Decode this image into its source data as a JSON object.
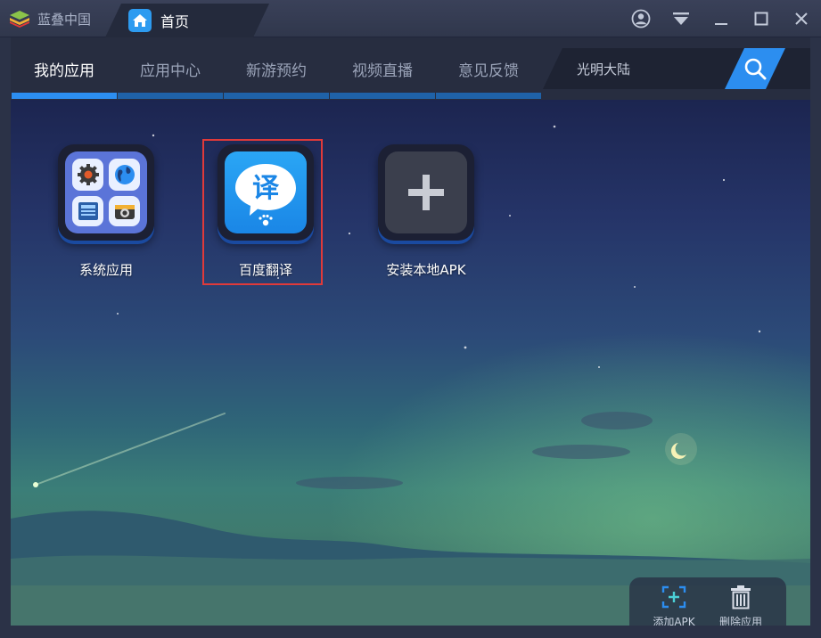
{
  "titlebar": {
    "app_name": "蓝叠中国",
    "home_tab": "首页"
  },
  "nav": {
    "tabs": [
      {
        "label": "我的应用",
        "active": true
      },
      {
        "label": "应用中心",
        "active": false
      },
      {
        "label": "新游预约",
        "active": false
      },
      {
        "label": "视频直播",
        "active": false
      },
      {
        "label": "意见反馈",
        "active": false
      }
    ],
    "search_text": "光明大陆"
  },
  "apps": [
    {
      "label": "系统应用",
      "icon": "system-apps-icon"
    },
    {
      "label": "百度翻译",
      "icon": "baidu-translate-icon",
      "highlighted": true
    },
    {
      "label": "安装本地APK",
      "icon": "plus-icon"
    }
  ],
  "dock": {
    "add_apk": "添加APK",
    "delete_app": "删除应用"
  },
  "colors": {
    "accent": "#2c8ef0",
    "highlight": "#e03a3a",
    "titlebar": "#3a4159",
    "navbar": "#272d40"
  }
}
